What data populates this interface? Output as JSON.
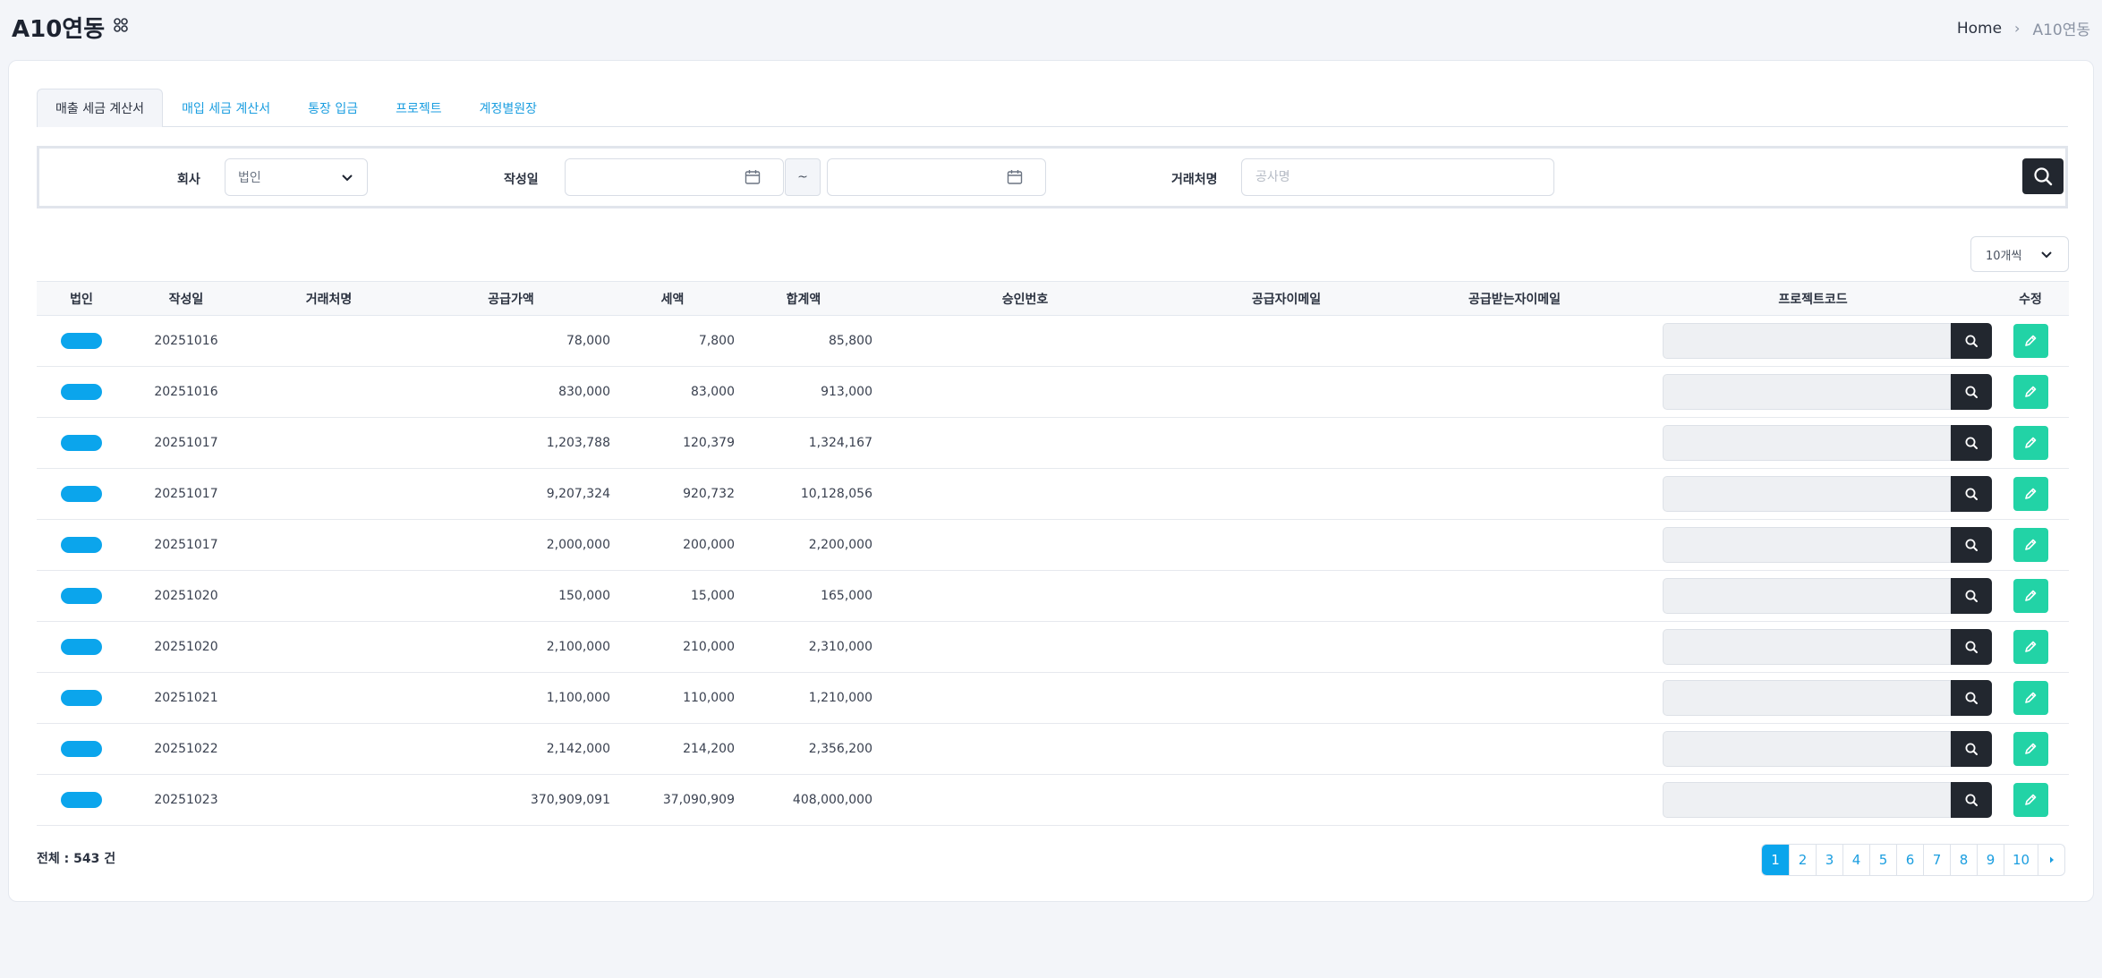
{
  "header": {
    "title": "A10연동",
    "apps_icon": "grid-icon",
    "breadcrumb": {
      "home": "Home",
      "separator": "›",
      "current": "A10연동"
    }
  },
  "tabs": [
    {
      "label": "매출 세금 계산서",
      "active": true
    },
    {
      "label": "매입 세금 계산서",
      "active": false
    },
    {
      "label": "통장 입금",
      "active": false
    },
    {
      "label": "프로젝트",
      "active": false
    },
    {
      "label": "계정별원장",
      "active": false
    }
  ],
  "filter": {
    "company_label": "회사",
    "company_value": "법인",
    "date_label": "작성일",
    "date_separator": "~",
    "client_label": "거래처명",
    "client_placeholder": "공사명",
    "search_icon": "search-icon"
  },
  "page_size": "10개씩",
  "columns": [
    "법인",
    "작성일",
    "거래처명",
    "공급가액",
    "세액",
    "합계액",
    "승인번호",
    "공급자이메일",
    "공급받는자이메일",
    "프로젝트코드",
    "수정"
  ],
  "rows": [
    {
      "date": "20251016",
      "client": "",
      "supply": "78,000",
      "tax": "7,800",
      "total": "85,800",
      "approval": "",
      "supplier_email": "",
      "receiver_email": ""
    },
    {
      "date": "20251016",
      "client": "",
      "supply": "830,000",
      "tax": "83,000",
      "total": "913,000",
      "approval": "",
      "supplier_email": "",
      "receiver_email": ""
    },
    {
      "date": "20251017",
      "client": "",
      "supply": "1,203,788",
      "tax": "120,379",
      "total": "1,324,167",
      "approval": "",
      "supplier_email": "",
      "receiver_email": ""
    },
    {
      "date": "20251017",
      "client": "",
      "supply": "9,207,324",
      "tax": "920,732",
      "total": "10,128,056",
      "approval": "",
      "supplier_email": "",
      "receiver_email": ""
    },
    {
      "date": "20251017",
      "client": "",
      "supply": "2,000,000",
      "tax": "200,000",
      "total": "2,200,000",
      "approval": "",
      "supplier_email": "",
      "receiver_email": ""
    },
    {
      "date": "20251020",
      "client": "",
      "supply": "150,000",
      "tax": "15,000",
      "total": "165,000",
      "approval": "",
      "supplier_email": "",
      "receiver_email": ""
    },
    {
      "date": "20251020",
      "client": "",
      "supply": "2,100,000",
      "tax": "210,000",
      "total": "2,310,000",
      "approval": "",
      "supplier_email": "",
      "receiver_email": ""
    },
    {
      "date": "20251021",
      "client": "",
      "supply": "1,100,000",
      "tax": "110,000",
      "total": "1,210,000",
      "approval": "",
      "supplier_email": "",
      "receiver_email": ""
    },
    {
      "date": "20251022",
      "client": "",
      "supply": "2,142,000",
      "tax": "214,200",
      "total": "2,356,200",
      "approval": "",
      "supplier_email": "",
      "receiver_email": ""
    },
    {
      "date": "20251023",
      "client": "",
      "supply": "370,909,091",
      "tax": "37,090,909",
      "total": "408,000,000",
      "approval": "",
      "supplier_email": "",
      "receiver_email": ""
    }
  ],
  "footer": {
    "total_text": "전체 : 543 건",
    "pages": [
      "1",
      "2",
      "3",
      "4",
      "5",
      "6",
      "7",
      "8",
      "9",
      "10"
    ],
    "current_page": "1",
    "next_icon": "caret-right-icon"
  },
  "colors": {
    "accent": "#0ba5ec",
    "link": "#1b9ee0",
    "edit": "#22d3a6",
    "dark": "#22272f"
  }
}
